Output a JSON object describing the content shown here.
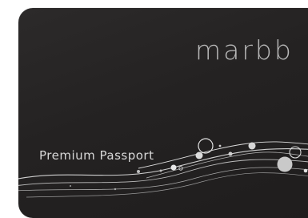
{
  "card": {
    "brand": "marbb",
    "tier": "Premium Passport",
    "background_color": "#262424",
    "accent_color": "#e0e0e0"
  }
}
